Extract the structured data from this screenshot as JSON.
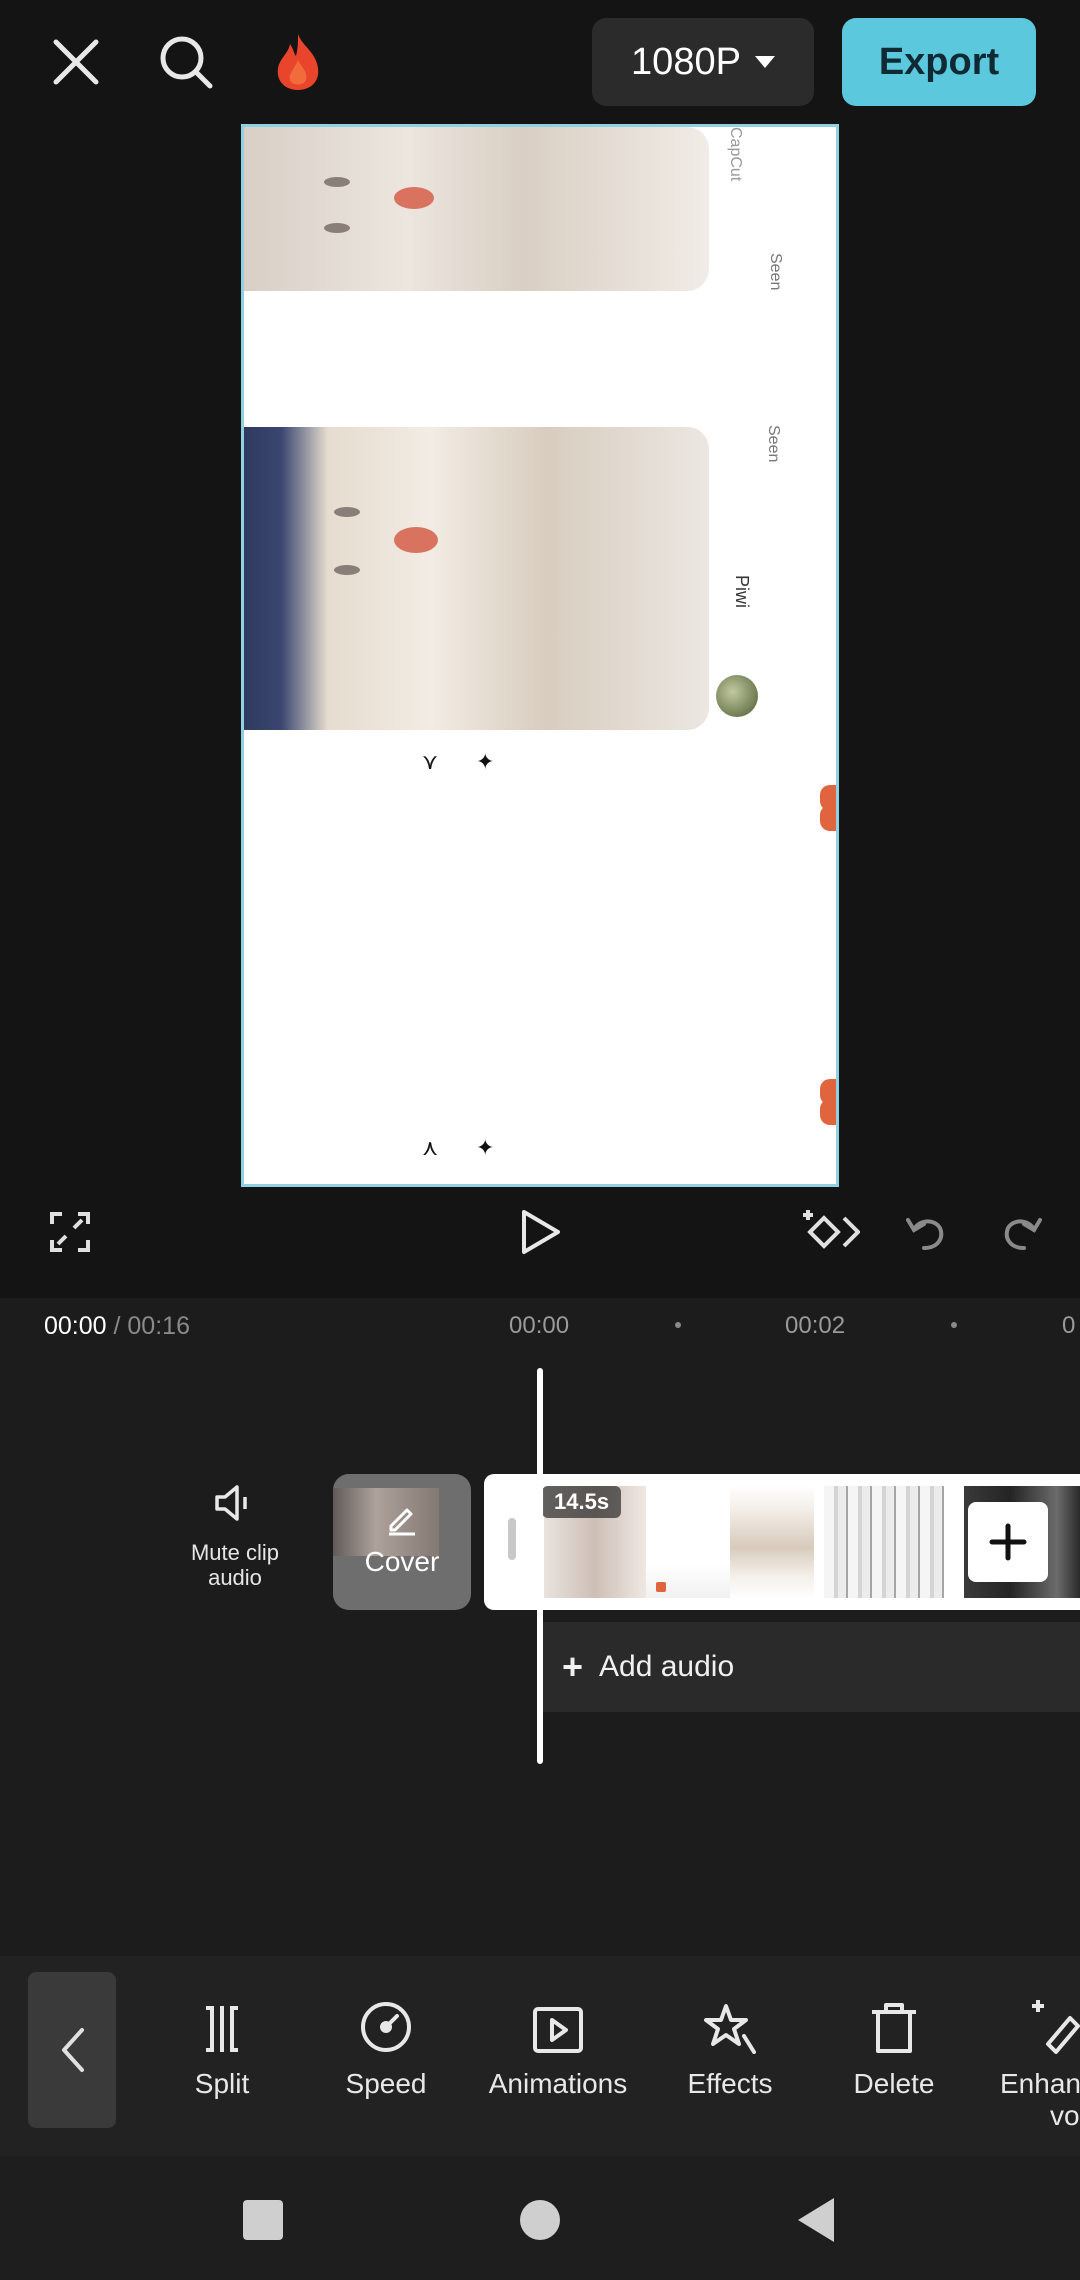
{
  "topbar": {
    "resolution": "1080P",
    "export_label": "Export",
    "close_icon": "close-icon",
    "search_icon": "search-icon",
    "fire_icon": "fire-icon"
  },
  "preview": {
    "seen_top": "Seen",
    "seen_mid": "Seen",
    "name": "Piwi",
    "watermark": "CapCut"
  },
  "timeline": {
    "current_time": "00:00",
    "total_time": "/ 00:16",
    "ticks": [
      "00:00",
      "00:02",
      "0"
    ],
    "mute_label": "Mute clip audio",
    "cover_label": "Cover",
    "clip_duration": "14.5s",
    "add_audio_label": "Add audio"
  },
  "toolbar": {
    "split": "Split",
    "speed": "Speed",
    "animations": "Animations",
    "effects": "Effects",
    "delete": "Delete",
    "enhance_line1": "Enhan",
    "enhance_line2": "voic"
  },
  "colors": {
    "accent": "#5bc8de",
    "background": "#141414",
    "preview_border": "#8fd1e3"
  }
}
